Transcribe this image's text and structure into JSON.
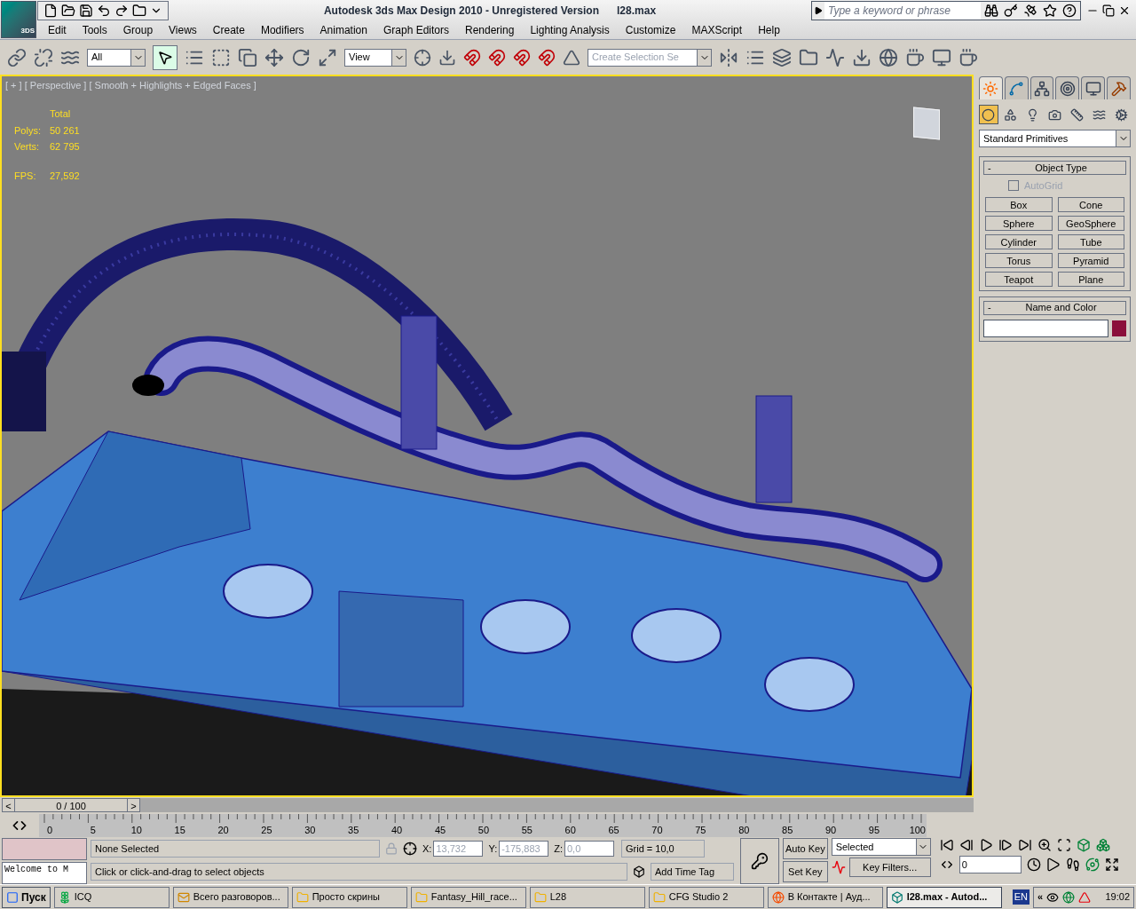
{
  "title_bar": {
    "app_badge": "3DS",
    "title": "Autodesk 3ds Max Design 2010  - Unregistered Version",
    "file": "l28.max",
    "search": {
      "placeholder": "Type a keyword or phrase"
    }
  },
  "menu": [
    "Edit",
    "Tools",
    "Group",
    "Views",
    "Create",
    "Modifiers",
    "Animation",
    "Graph Editors",
    "Rendering",
    "Lighting Analysis",
    "Customize",
    "MAXScript",
    "Help"
  ],
  "toolbar": {
    "selection_filter": "All",
    "reference_coord": "View",
    "named_selection": {
      "placeholder": "Create Selection Se"
    },
    "select_active": true
  },
  "viewport": {
    "label": "[ + ] [ Perspective ] [ Smooth + Highlights + Edged Faces ]",
    "stats_header": "Total",
    "stats": [
      {
        "label": "Polys:",
        "value": "50 261"
      },
      {
        "label": "Verts:",
        "value": "62 795"
      }
    ],
    "fps": {
      "label": "FPS:",
      "value": "27,592"
    },
    "active": true
  },
  "command_panel": {
    "tabs": [
      {
        "kind": "create",
        "selected": true
      },
      {
        "kind": "modify",
        "selected": false
      },
      {
        "kind": "hierarchy",
        "selected": false
      },
      {
        "kind": "motion",
        "selected": false
      },
      {
        "kind": "display",
        "selected": false
      },
      {
        "kind": "utilities",
        "selected": false
      }
    ],
    "categories": [
      {
        "kind": "geometry",
        "selected": true
      },
      {
        "kind": "shapes",
        "selected": false
      },
      {
        "kind": "lights",
        "selected": false
      },
      {
        "kind": "cameras",
        "selected": false
      },
      {
        "kind": "helpers",
        "selected": false
      },
      {
        "kind": "spacewarps",
        "selected": false
      },
      {
        "kind": "systems",
        "selected": false
      }
    ],
    "dropdown": "Standard Primitives",
    "object_type": {
      "collapse": "-",
      "title": "Object Type",
      "autogrid": {
        "label": "AutoGrid",
        "checked": false,
        "disabled": true
      },
      "buttons": [
        "Box",
        "Cone",
        "Sphere",
        "GeoSphere",
        "Cylinder",
        "Tube",
        "Torus",
        "Pyramid",
        "Teapot",
        "Plane"
      ]
    },
    "name_and_color": {
      "collapse": "-",
      "title": "Name and Color",
      "color": "#8b0f3a"
    }
  },
  "time_slider": {
    "prev": "<",
    "next": ">",
    "label": "0 / 100",
    "level": 0
  },
  "track_bar": {
    "ticks": [
      "0",
      "5",
      "10",
      "15",
      "20",
      "25",
      "30",
      "35",
      "40",
      "45",
      "50",
      "55",
      "60",
      "65",
      "70",
      "75",
      "80",
      "85",
      "90",
      "95",
      "100"
    ]
  },
  "status": {
    "listener": "Welcome to M",
    "selection": "None Selected",
    "prompt": "Click or click-and-drag to select objects",
    "coords": [
      {
        "label": "X:",
        "value": "13,732"
      },
      {
        "label": "Y:",
        "value": "-175,883"
      },
      {
        "label": "Z:",
        "value": "0,0"
      }
    ],
    "grid": "Grid = 10,0",
    "time_tag": "Add Time Tag",
    "auto_key": "Auto Key",
    "set_key": "Set Key",
    "key_mode": "Selected",
    "key_filters": "Key Filters...",
    "frame": "0"
  },
  "taskbar": {
    "start": "Пуск",
    "items": [
      {
        "kind": "icq",
        "label": "ICQ",
        "selected": false
      },
      {
        "kind": "note",
        "label": "Всего разговоров...",
        "selected": false
      },
      {
        "kind": "folder",
        "label": "Просто скрины",
        "selected": false
      },
      {
        "kind": "folder",
        "label": "Fantasy_Hill_race...",
        "selected": false
      },
      {
        "kind": "folder",
        "label": "L28",
        "selected": false
      },
      {
        "kind": "folder",
        "label": "CFG Studio 2",
        "selected": false
      },
      {
        "kind": "browser",
        "label": "В Контакте | Ауд...",
        "selected": false
      },
      {
        "kind": "max",
        "label": "l28.max - Autod...",
        "selected": true
      }
    ],
    "language": "EN",
    "tray_expand": "«",
    "clock": "19:02"
  }
}
